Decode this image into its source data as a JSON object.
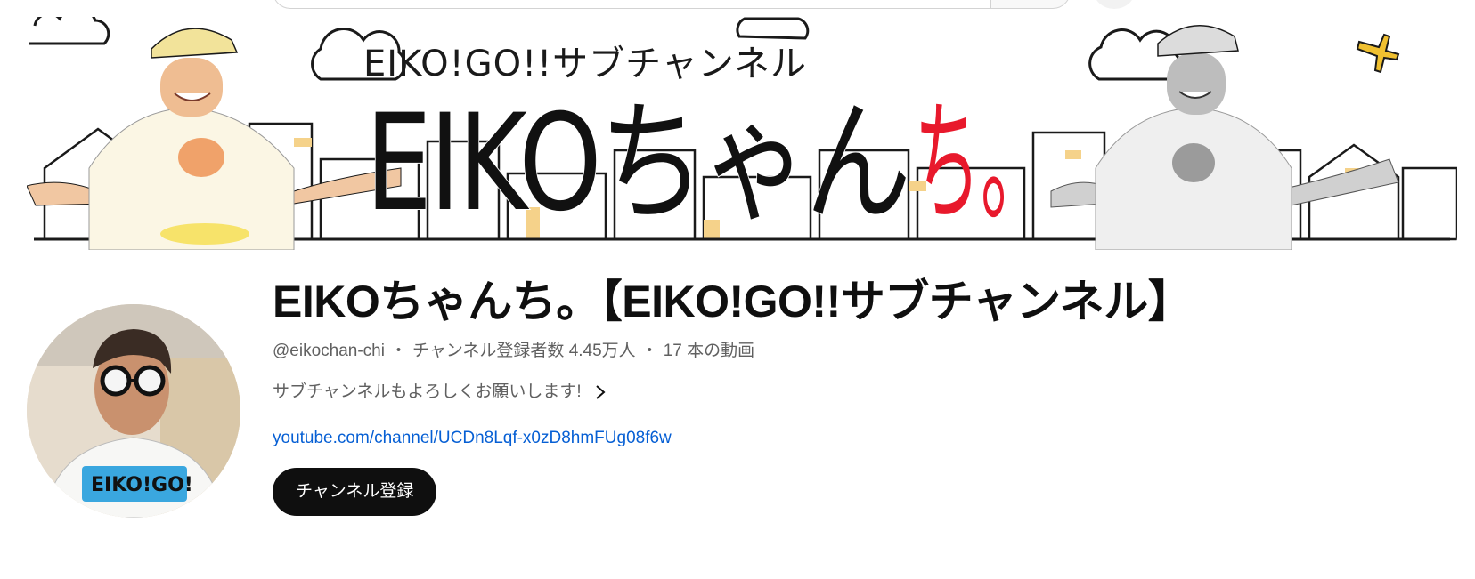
{
  "banner": {
    "subtitle": "EIKO!GO!!サブチャンネル",
    "logo_main": "EIKOちゃん",
    "logo_accent": "ち。"
  },
  "channel": {
    "title": "EIKOちゃんち。【EIKO!GO!!サブチャンネル】",
    "handle": "@eikochan-chi",
    "separator": "・",
    "subscribers": "チャンネル登録者数 4.45万人",
    "videos": "17 本の動画",
    "description": "サブチャンネルもよろしくお願いします!",
    "link": "youtube.com/channel/UCDn8Lqf-x0zD8hmFUg08f6w",
    "subscribe_label": "チャンネル登録",
    "avatar_shirt_text": "EIKO!GO!"
  },
  "icons": {
    "description_more": "chevron-right-icon"
  },
  "colors": {
    "accent_red": "#e8192c",
    "link_blue": "#065fd4",
    "button_black": "#0f0f0f",
    "meta_gray": "#606060"
  }
}
